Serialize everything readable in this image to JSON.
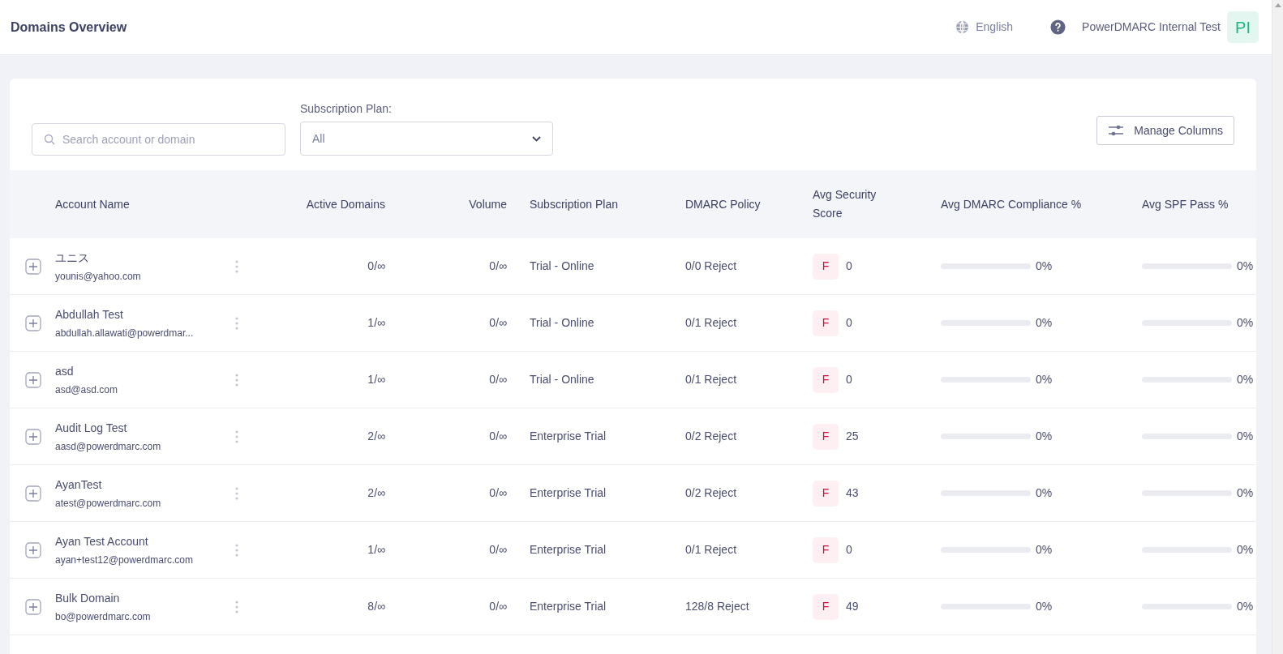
{
  "header": {
    "title": "Domains Overview",
    "language": "English",
    "organization": "PowerDMARC Internal Test",
    "avatar": "PI"
  },
  "filters": {
    "search": {
      "placeholder": "Search account or domain"
    },
    "plan_label": "Subscription Plan:",
    "plan_value": "All",
    "manage_columns": "Manage Columns"
  },
  "table": {
    "columns": [
      "Account Name",
      "Active Domains",
      "Volume",
      "Subscription Plan",
      "DMARC Policy",
      "Avg Security Score",
      "Avg DMARC Compliance %",
      "Avg SPF Pass %"
    ],
    "rows": [
      {
        "name": "ユニス",
        "email": "younis@yahoo.com",
        "active_domains": "0/∞",
        "volume": "0/∞",
        "plan": "Trial - Online",
        "policy": "0/0 Reject",
        "grade": "F",
        "score": "0",
        "compliance": {
          "level": 0,
          "text": "0%"
        },
        "spf": {
          "level": 0,
          "text": "0%"
        }
      },
      {
        "name": "Abdullah Test",
        "email": "abdullah.allawati@powerdmar...",
        "active_domains": "1/∞",
        "volume": "0/∞",
        "plan": "Trial - Online",
        "policy": "0/1 Reject",
        "grade": "F",
        "score": "0",
        "compliance": {
          "level": 0,
          "text": "0%"
        },
        "spf": {
          "level": 0,
          "text": "0%"
        }
      },
      {
        "name": "asd",
        "email": "asd@asd.com",
        "active_domains": "1/∞",
        "volume": "0/∞",
        "plan": "Trial - Online",
        "policy": "0/1 Reject",
        "grade": "F",
        "score": "0",
        "compliance": {
          "level": 0,
          "text": "0%"
        },
        "spf": {
          "level": 0,
          "text": "0%"
        }
      },
      {
        "name": "Audit Log Test",
        "email": "aasd@powerdmarc.com",
        "active_domains": "2/∞",
        "volume": "0/∞",
        "plan": "Enterprise Trial",
        "policy": "0/2 Reject",
        "grade": "F",
        "score": "25",
        "compliance": {
          "level": 0,
          "text": "0%"
        },
        "spf": {
          "level": 0,
          "text": "0%"
        }
      },
      {
        "name": "AyanTest",
        "email": "atest@powerdmarc.com",
        "active_domains": "2/∞",
        "volume": "0/∞",
        "plan": "Enterprise Trial",
        "policy": "0/2 Reject",
        "grade": "F",
        "score": "43",
        "compliance": {
          "level": 0,
          "text": "0%"
        },
        "spf": {
          "level": 0,
          "text": "0%"
        }
      },
      {
        "name": "Ayan Test Account",
        "email": "ayan+test12@powerdmarc.com",
        "active_domains": "1/∞",
        "volume": "0/∞",
        "plan": "Enterprise Trial",
        "policy": "0/1 Reject",
        "grade": "F",
        "score": "0",
        "compliance": {
          "level": 0,
          "text": "0%"
        },
        "spf": {
          "level": 0,
          "text": "0%"
        }
      },
      {
        "name": "Bulk Domain",
        "email": "bo@powerdmarc.com",
        "active_domains": "8/∞",
        "volume": "0/∞",
        "plan": "Enterprise Trial",
        "policy": "128/8 Reject",
        "grade": "F",
        "score": "49",
        "compliance": {
          "level": 0,
          "text": "0%"
        },
        "spf": {
          "level": 0,
          "text": "0%"
        }
      }
    ]
  }
}
